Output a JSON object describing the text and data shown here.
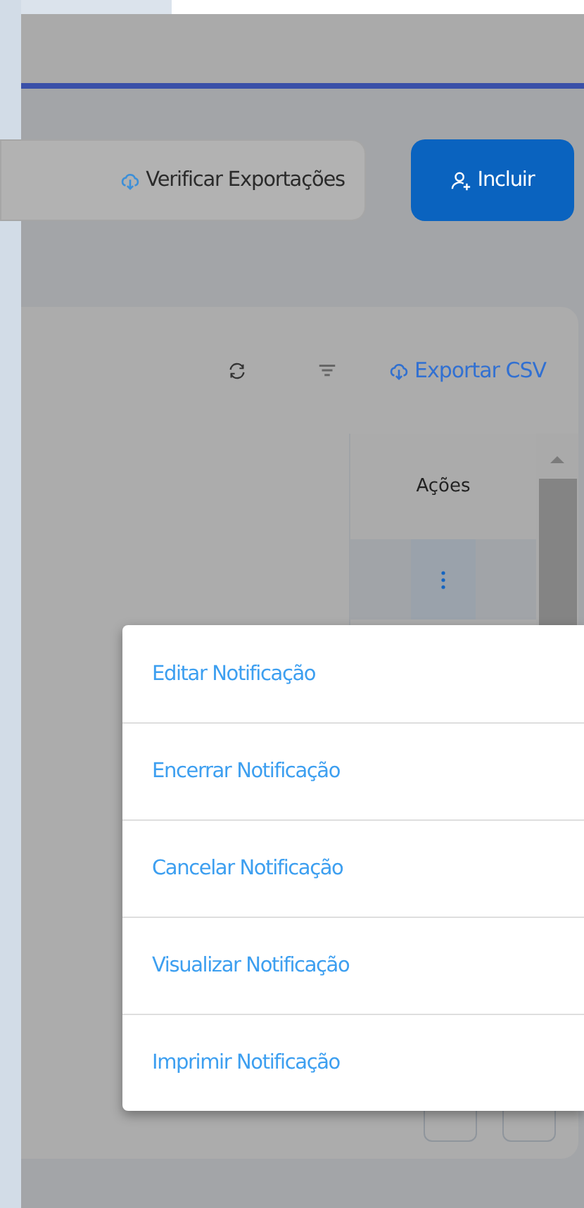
{
  "actions": [
    {
      "label": "Verificar Exportações",
      "kind": "secondary"
    },
    {
      "label": "Incluir",
      "kind": "primary"
    }
  ],
  "table": {
    "export_link": "Exportar CSV",
    "columns": [
      "Ações"
    ]
  },
  "row_menu": {
    "items": [
      "Editar Notificação",
      "Encerrar Notificação",
      "Cancelar Notificação",
      "Visualizar Notificação",
      "Imprimir Notificação"
    ]
  }
}
